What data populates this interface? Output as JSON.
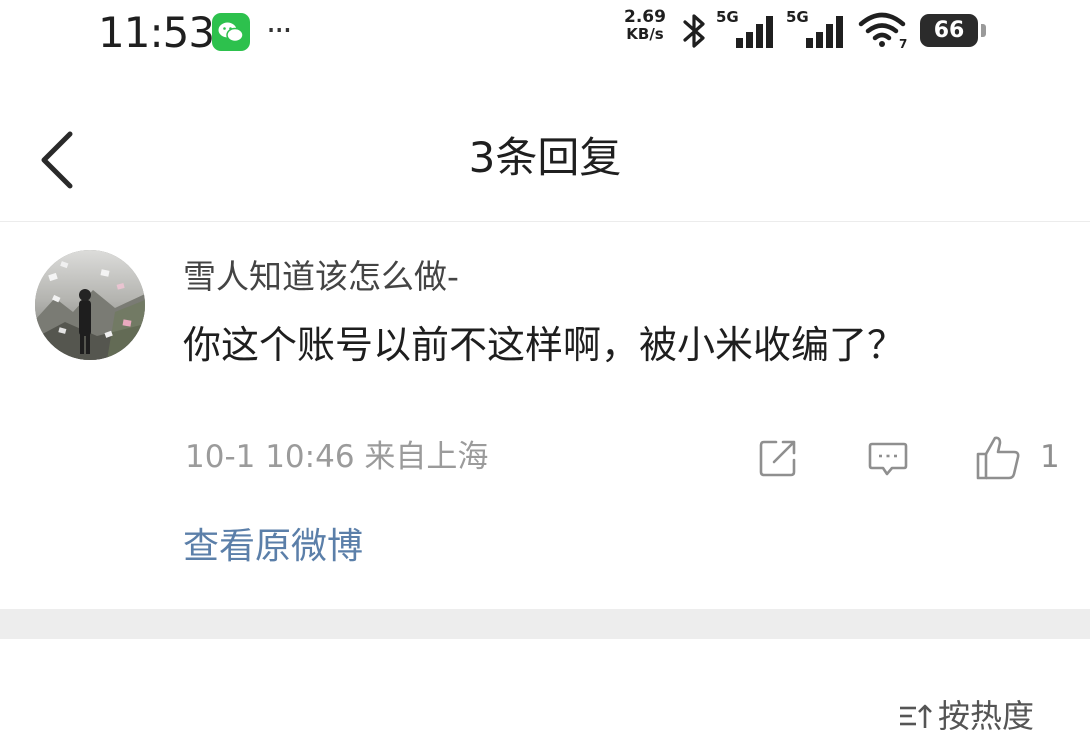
{
  "status_bar": {
    "time": "11:53",
    "more_dots": "···",
    "net_speed_value": "2.69",
    "net_speed_unit": "KB/s",
    "signal_1_label": "5G",
    "signal_2_label": "5G",
    "battery_level": "66",
    "icons": [
      "wechat-icon",
      "bluetooth-icon",
      "signal-5g-icon",
      "signal-5g-icon",
      "wifi-icon",
      "battery-icon"
    ]
  },
  "header": {
    "title": "3条回复",
    "back_icon": "chevron-left-icon"
  },
  "comment": {
    "username": "雪人知道该怎么做-",
    "text": "你这个账号以前不这样啊，被小米收编了？",
    "timestamp": "10-1 10:46",
    "location": "来自上海",
    "like_count": "1",
    "view_original_label": "查看原微博",
    "actions": [
      "share-icon",
      "comment-icon",
      "like-icon"
    ]
  },
  "sort": {
    "label": "按热度",
    "icon": "sort-icon"
  },
  "colors": {
    "link": "#5b7fa9",
    "meta_text": "#9b9b9b",
    "separator": "#ededed",
    "wechat_green": "#2dc14d"
  }
}
